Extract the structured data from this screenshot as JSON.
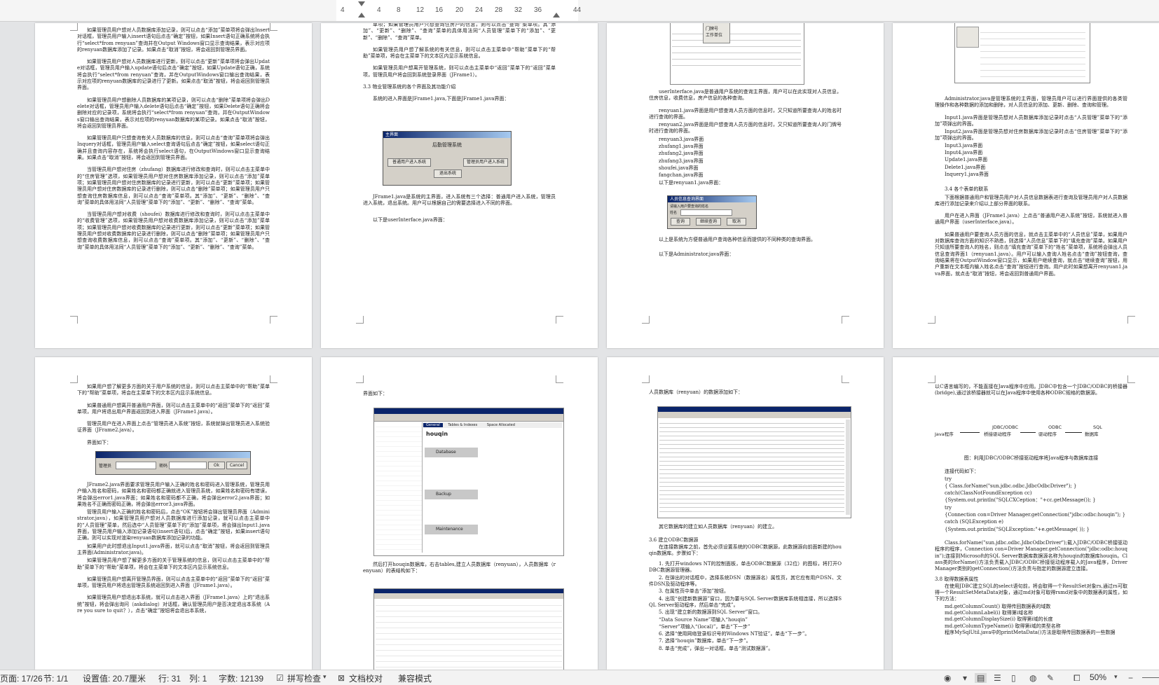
{
  "ruler": {
    "labels": [
      "4",
      "4",
      "8",
      "12",
      "16",
      "20",
      "24",
      "28",
      "32",
      "36",
      "44"
    ]
  },
  "pages": {
    "p1": [
      "如果管理员用户想对人员数据库添加记录，则可以点击“添加”菜单项将会弹出Insert对话框，管理员用户输入insert语句后点击“确定”按钮，如果Insert语句正确系统将会执行“select*from renyuan”查询并在Output Windows窗口显示查询结果，表示对应项的renyuan数据库添加了记录。如果点击“取消”按钮，将会返回到管理员界面。",
      "如果管理员用户想对人员数据库进行更新，则可以点击“更新”菜单项将会弹出Update对话框，管理员用户输入update语句后点击“确定”按钮，如果Update语句正确，系统将会执行“select*from renyuan”查询，并在OutputWindows窗口输出查询结果，表示对应项的renyuan数据库的记录进行了更新。如果点击“取消”按钮，将会返回到管理员界面。",
      "如果管理员用户想删除人员数据库的某项记录，则可以点击“删除”菜单项将会弹出Delete对话框，管理员用户输入delete语句后点击“确定”按钮，如果Delete语句正确将会删除对应的记录项，系统将会执行“select*from renyuan”查询，并在OutputWindows窗口输出查询结果，表示对应项的renyuan数据库的某项记录。如果点击“取消”按钮，将会返回到管理员界面。",
      "如果管理员用户只想查询有关人员数据库的信息，则可以点击“查询”菜单项将会弹出Inquery对话框，管理员用户输入select查询语句后点击“确定”按钮，如果select语句正确并且查询内容存在，系统将会执行select语句，在OutputWindows窗口显示查询结果。如果点击“取消”按钮，将会返回到管理员界面。",
      "当管理员用户想对住房（zhufang）数据库进行修改和查询时，则可以点击主菜单中的“住房管理”选项，如果管理员用户想对住房数据库添加记录，则可以点击“添加”菜单项；如果管理员用户想对住房数据库的记录进行更新，则可以点击“更新”菜单项；如果管理员用户想对住房数据库的记录进行删除，则可以点击“删除”菜单项；如果管理员用户只想查询住房数据库信息，则可以点击“查询”菜单项。其“添加”、“更新”、“删除”、“查询”菜单的具体用法同“人员管理”菜单下的“添加”、“更新”、“删除”、“查询”菜单。",
      "当管理员用户想对收费（shoufei）数据库进行修改和查询时，则可以点击主菜单中的“收费管理”选项，如果管理员用户想对收费数据库添加记录，则可以点击“添加”菜单项；如果管理员用户想对收费数据库的记录进行更新，则可以点击“更新”菜单项；如果管理员用户想对收费数据库的记录进行删除，则可以点击“删除”菜单项；如果管理员用户只想查询收费数据库信息，则可以点击“查询”菜单项。其“添加”、“更新”、“删除”、“查询”菜单的具体用法同“人员管理”菜单下的“添加”、“更新”、“删除”、“查询”菜单。"
    ],
    "p2": [
      "单项；如果管理员用户只想查询住房户的信息，则可以点击“查询”菜单项。其“添加”、“更新”、“删除”、“查询”菜单的具体用法同“人员管理”菜单下的“添加”、“更新”、“删除”、“查询”菜单。",
      "如果管理员用户想了解系统的有关信息，则可以点击主菜单中“帮助”菜单下的“帮助”菜单项，将会在主菜单下的文本区内显示系统信息。",
      "如果管理员用户想离开管理系统，则可以点击主菜单中“返回”菜单下的“返回”菜单项，管理员用户将会回到系统登录界面（JFrame1）。",
      "3.3 物业管理系统的各个界面及其功能介绍",
      "系统的进入界面是JFrame1.java,下面是JFrame1.java界面：",
      "JFrame1.java是系统的主界面，进入系统有三个选择：普通用户进入系统，管理员进入系统，退出系统。用户可以根据自己的需要选择进入不同的界面。",
      "以下是userInterface.java界面："
    ],
    "p3": [
      "userInterface.java是普通用户系统的查询主界面，用户可以在此实现对人员信息，住房信息，收费信息，房产信息的各种查询。",
      "renyuan1.java界面是用户想查询人员方面的信息时，又只知道所要查询人的姓名时进行查询的界面。",
      "renyuan2.java界面是用户想查询人员方面的信息时，又只知道所要查询人的门牌号时进行查询的界面。",
      "renyuan3.java界面",
      "zhufang1.java界面",
      "zhufang2.java界面",
      "zhufang3.java界面",
      "shoufei.java界面",
      "fangchan.java界面",
      "以下是renyuan1.java界面：",
      "以上是系统为方便普通用户查询各种信息而提供的不同种类的查询界面。",
      "以下是Administrator.java界面："
    ],
    "p4": [
      "Administrator.java是管理系统的主界面，管理员用户可以进行界面提供的各类管理操作和各种数据的添加和删除，对人员信息的添加、更新、删除、查询和管理。",
      "Input1.java界面是管理员想对人员数据库添加记录时点击“人员管理”菜单下的“添加”项弹出的界面。",
      "Input2.java界面是管理员想对住房数据库添加记录时点击“住房管理”菜单下的“添加”项弹出的界面。",
      "Input3.java界面",
      "Input4.java界面",
      "Update1.java界面",
      "Delete1.java界面",
      "Inquery1.java界面",
      "3.4 各个表单的联系",
      "下面根据普通用户和管理员用户对人员信息数据表进行查询及管理员用户对人员数据库进行添加记录来介绍以上部分界面的联系。",
      "用户在进入界面（JFrame1.java）上点击“普通用户进入系统”按钮，系统就进入普通用户界面（userInterface.java）。",
      "如果普通用户要查询人员方面的信息，就点击主菜单中的“人员信息”菜单，如果用户对数据库查询方面的知识不熟悉，则选择“人员信息”菜单下的“填充查询”菜单。如果用户只知道所要查询人的姓名，则点击“填充查询”菜单下的“姓名”菜单项，系统将会弹出人员信息查询界面1（renyuan1.java）。用户可以输入查询人姓名点击“查询”按钮查询，查询结果将在OutputWindow窗口显示，如果用户继续查询，就点击“继续查询”按钮，用户重新在文本框内输入姓名点击“查询”按钮进行查询。用户此时如果想离开renyuan1.java界面，就点击“取消”按钮，将会返回到普通用户界面。"
    ],
    "p5": [
      "如果用户想了解更多方面的关于用户系统的信息，则可以点击主菜单中的“帮助”菜单下的“帮助”菜单项，将会在主菜单下的文本区内显示系统信息。",
      "如果普通用户想离开普通用户界面，则可以点击主菜单中的“返回”菜单下的“返回”菜单项，用户将退出用户界面返回到进入界面（JFrame1.java）。",
      "管理员用户在进入界面上点击“管理员进入系统”按钮，系统就弹出管理员进入系统验证界面（JFrame2.java）。",
      "界面如下：",
      "JFrame2.java界面要求管理员用户输入正确的姓名和密码进入管理系统，管理员用户输入姓名和密码，如果姓名和密码都正确就进入管理员系统，如果姓名和密码有错误，将会弹出error1.java界面；如果姓名和密码都不正确，将会弹出error2.java界面；如果姓名不正确而密码正确，将会弹出error3.java界面。",
      "管理员用户输入正确的姓名和密码后，点击“OK”按钮将会弹出管理员界面（Administrator.java），如果管理员用户想对人员数据库进行添加记录，就可以点击主菜单中的“人员管理”菜单，然后选中“人员管理”菜单下的“添加”菜单项，将会弹出Input1.java界面，管理员用户输入添加记录语句(insert语句)后，点击“确定”按钮，如果insert语句正确，则可以实现对渲染renyuan数据库添加记录的功能。",
      "如果用户此时想退出Input1.java界面，就可以点击“取消”按钮，将会返回到管理员主界面(Administrator.java)。",
      "如果管理员用户想了解更多方面的关于管理系统的信息，则可以点击主菜单中的“帮助”菜单下的“帮助”菜单项，将会在主菜单下的文本区内显示系统信息。",
      "如果管理员用户想离开管理员界面，则可以点击主菜单中的“返回”菜单下的“返回”菜单项，管理员用户将退出管理员系统返回到进入界面（JFrame1.java）。",
      "如果管理员用户想退出本系统，就可以点击进入界面（JFrame1.java）上的“退出系统”按钮，将会弹出询问（askdialog）对话框，确认管理员用户是否决定退出本系统（Are you sure to quit？），点击“确定”按钮将会退出本系统，"
    ],
    "p6": [
      "界面如下：",
      "然后打开houqin数据库，右击tables,建立人员数据库（renyuan），人员数据库（renyuan）的表结构如下："
    ],
    "p7": [
      "人员数据库（renyuan）的数据添加如下：",
      "其它数据库的建立如人员数据库（renyuan）的建立。",
      "3.6 建立ODBC数据源",
      "在连接数据库之前，首先必须设置系统的ODBC数据源，此数据源向前面新建的houqin数据库。步骤如下：",
      "1. 先打开windows NT的控制面板，单击ODBC数据源（32位）的图标，将打开ODBC数据源管理器。",
      "2. 在弹出的对话框中，选择系统DSN（数据源名）属性页，其它应有用户DSN、文件DSN及驱动程序等。",
      "3. 在属性页中单击“添加”按钮。",
      "4. 出现“创建新数据源”窗口，因为要与SQL Server数据库系统相连接，所以选择SQL Server驱动程序，然后单击“完成”。",
      "5. 出现“建立新的数据源到SQL Server”窗口。",
      "“Data Source Name”项输入“houqin”",
      "“Server”项输入“(local)”，单击“下一步”",
      "6. 选择“使用网络登录标识号的Windows NT验证”，单击“下一步”。",
      "7. 选择“houqin”数据库，单击“下一步”。",
      "8. 单击“完成”，弹出一对话框，单击“测试数据源”。"
    ],
    "p8": [
      "以C语言编写的，不能直接在Java程序中应用。JDBC中包含一个JDBC/ODBC的桥接器(bridge),通过该桥接器就可以在Java程序中使用各种ODBC规格的数据源。",
      "图：利用JDBC/ODBC桥接驱动程序将Java程序与数据库连接",
      "连接代码如下：",
      "try",
      "{ Class.forName(\"sun.jdbc.odbc.JdbcOdbcDriver\"); }",
      "catch(ClassNotFoundException  cc)",
      "{System.out.println(\"SQLCXCeption：\"+cc.getMessage()); }",
      "try",
      "{Connection  con=Driver Manager.getConnection(\"jdbc:odbc:houqin\"); }",
      "catch (SQLException e)",
      "{System.out.println(\"SQLException:\"+e.getMessage( )); }",
      "Class.forName(\"sun.jdbc.odbc.JdbcOdbcDriver\");载入JDBC/ODBC桥接驱动程序的程序，Connection con=Driver Manager.getConnection(\"jdbc:odbc:houqin\");连接到Microsoft的SQL Server数据库数据源名称为houqin的数据库houqin。Class类的forName()方法负责载入JDBC/ODBC桥接驱动程序载入的Java程序，DriverManager类别的getConnection()方法负责与指定的数据源建立连接。",
      "3.8 取得数据表属性",
      "在使用JDBC建立SQL的select语句前，将会取得一个ResultSet对象rs,通过rs可取得一个ResultSetMetaData对象，通过md对象可取得rsmd对象中的数据表的属性，如下的方法：",
      "md.getColumnCount()    取得传回数据表的域数",
      "md.getColumnLabel(i)    取得第i域名称",
      "md.getColumnDisplaySize(i)  取得第i域的长度",
      "md.getColumnTypeName(i)  取得第i域的类型名称",
      "程序MySqlUtil.java中的printMetaData()方法是取得传回数据表的一些数据"
    ]
  },
  "dialogs": {
    "jframe1": {
      "title": "主界面",
      "heading": "后勤管理系统",
      "btn_user": "普通用户进入系统",
      "btn_admin": "管理员用户进入系统",
      "btn_exit": "退出系统"
    },
    "renyuan1": {
      "title": "人员信息查询界面",
      "prompt": "请输入用户要查询的姓名",
      "field_label": "姓名",
      "btn_query": "查询",
      "btn_continue": "继续查询",
      "btn_cancel": "取消"
    },
    "jframe2": {
      "user_label": "管理员",
      "pwd_label": "密码",
      "btn_ok": "Ok",
      "btn_cancel": "Cancel"
    },
    "help_popup": {
      "items": [
        "门牌号",
        "工作单位"
      ]
    }
  },
  "figure": {
    "java": "Java程序",
    "bridge_top": "JDBC/ODBC",
    "bridge_bottom": "桥接驱动程序",
    "odbc_top": "ODBC",
    "odbc_bottom": "驱动程序",
    "sql_top": "SQL",
    "sql_bottom": "数据库"
  },
  "enterprise": {
    "db_name": "houqin",
    "tabs": [
      "General",
      "Tables & Indexes",
      "Space Allocated"
    ],
    "section_database": "Database",
    "section_backup": "Backup",
    "section_maintenance": "Maintenance"
  },
  "status": {
    "page": "页面: 17/26",
    "section": "节: 1/1",
    "setting": "设置值: 20.7厘米",
    "row": "行: 31",
    "col": "列: 1",
    "words": "字数: 12139",
    "spell": "拼写检查",
    "proof": "文档校对",
    "compat": "兼容模式",
    "zoom": "50%"
  }
}
